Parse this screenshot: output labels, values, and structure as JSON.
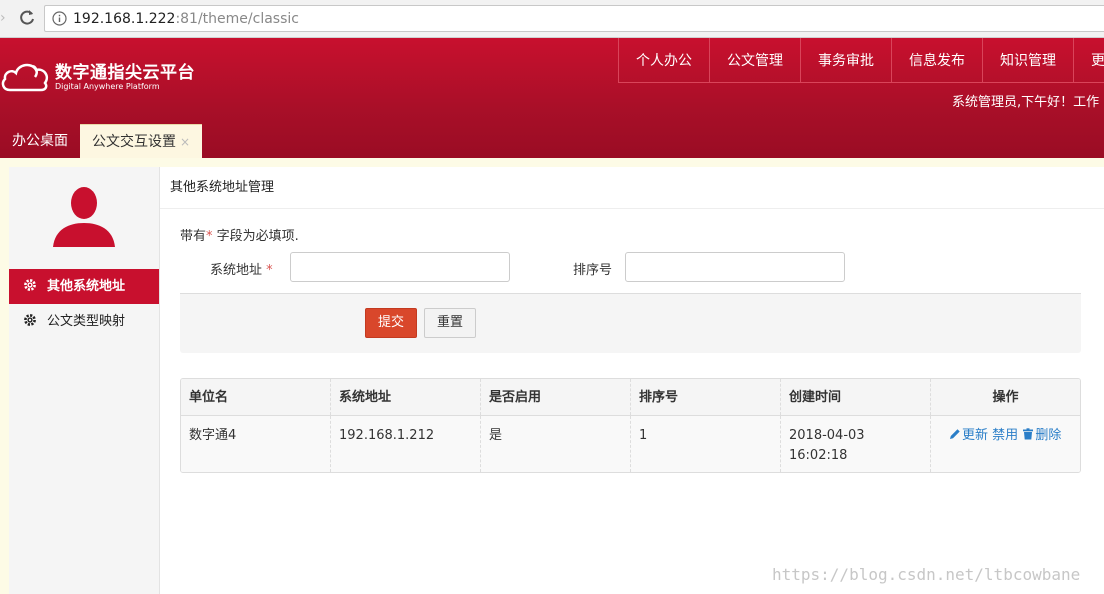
{
  "browser": {
    "url_host": "192.168.1.222",
    "url_rest": ":81/theme/classic"
  },
  "brand": {
    "title": "数字通指尖云平台",
    "subtitle": "Digital Anywhere Platform"
  },
  "topnav": [
    {
      "label": "个人办公"
    },
    {
      "label": "公文管理"
    },
    {
      "label": "事务审批"
    },
    {
      "label": "信息发布"
    },
    {
      "label": "知识管理"
    },
    {
      "label": "更"
    }
  ],
  "greeting": "系统管理员,下午好！工作",
  "tabs": [
    {
      "label": "办公桌面",
      "active": false
    },
    {
      "label": "公文交互设置",
      "active": true,
      "close": "×"
    }
  ],
  "sidebar": {
    "items": [
      {
        "label": "其他系统地址",
        "icon": "gear-icon",
        "active": true
      },
      {
        "label": "公文类型映射",
        "icon": "gear-icon",
        "active": false
      }
    ]
  },
  "main": {
    "title": "其他系统地址管理",
    "required_note_prefix": "带有",
    "required_star": "*",
    "required_note_suffix": " 字段为必填项.",
    "fields": {
      "address_label": "系统地址",
      "address_value": "",
      "sort_label": "排序号",
      "sort_value": ""
    },
    "buttons": {
      "submit": "提交",
      "reset": "重置"
    }
  },
  "table": {
    "headers": [
      "单位名",
      "系统地址",
      "是否启用",
      "排序号",
      "创建时间",
      "操作"
    ],
    "rows": [
      {
        "unit": "数字通4",
        "address": "192.168.1.212",
        "enabled": "是",
        "sort": "1",
        "created": "2018-04-03 16:02:18",
        "ops": {
          "update": "更新",
          "disable": "禁用",
          "delete": "删除"
        }
      }
    ]
  },
  "watermark": "https://blog.csdn.net/ltbcowbane",
  "colors": {
    "brand_red": "#c8102e",
    "submit_red": "#d9472b",
    "link_blue": "#2a7ec8"
  }
}
